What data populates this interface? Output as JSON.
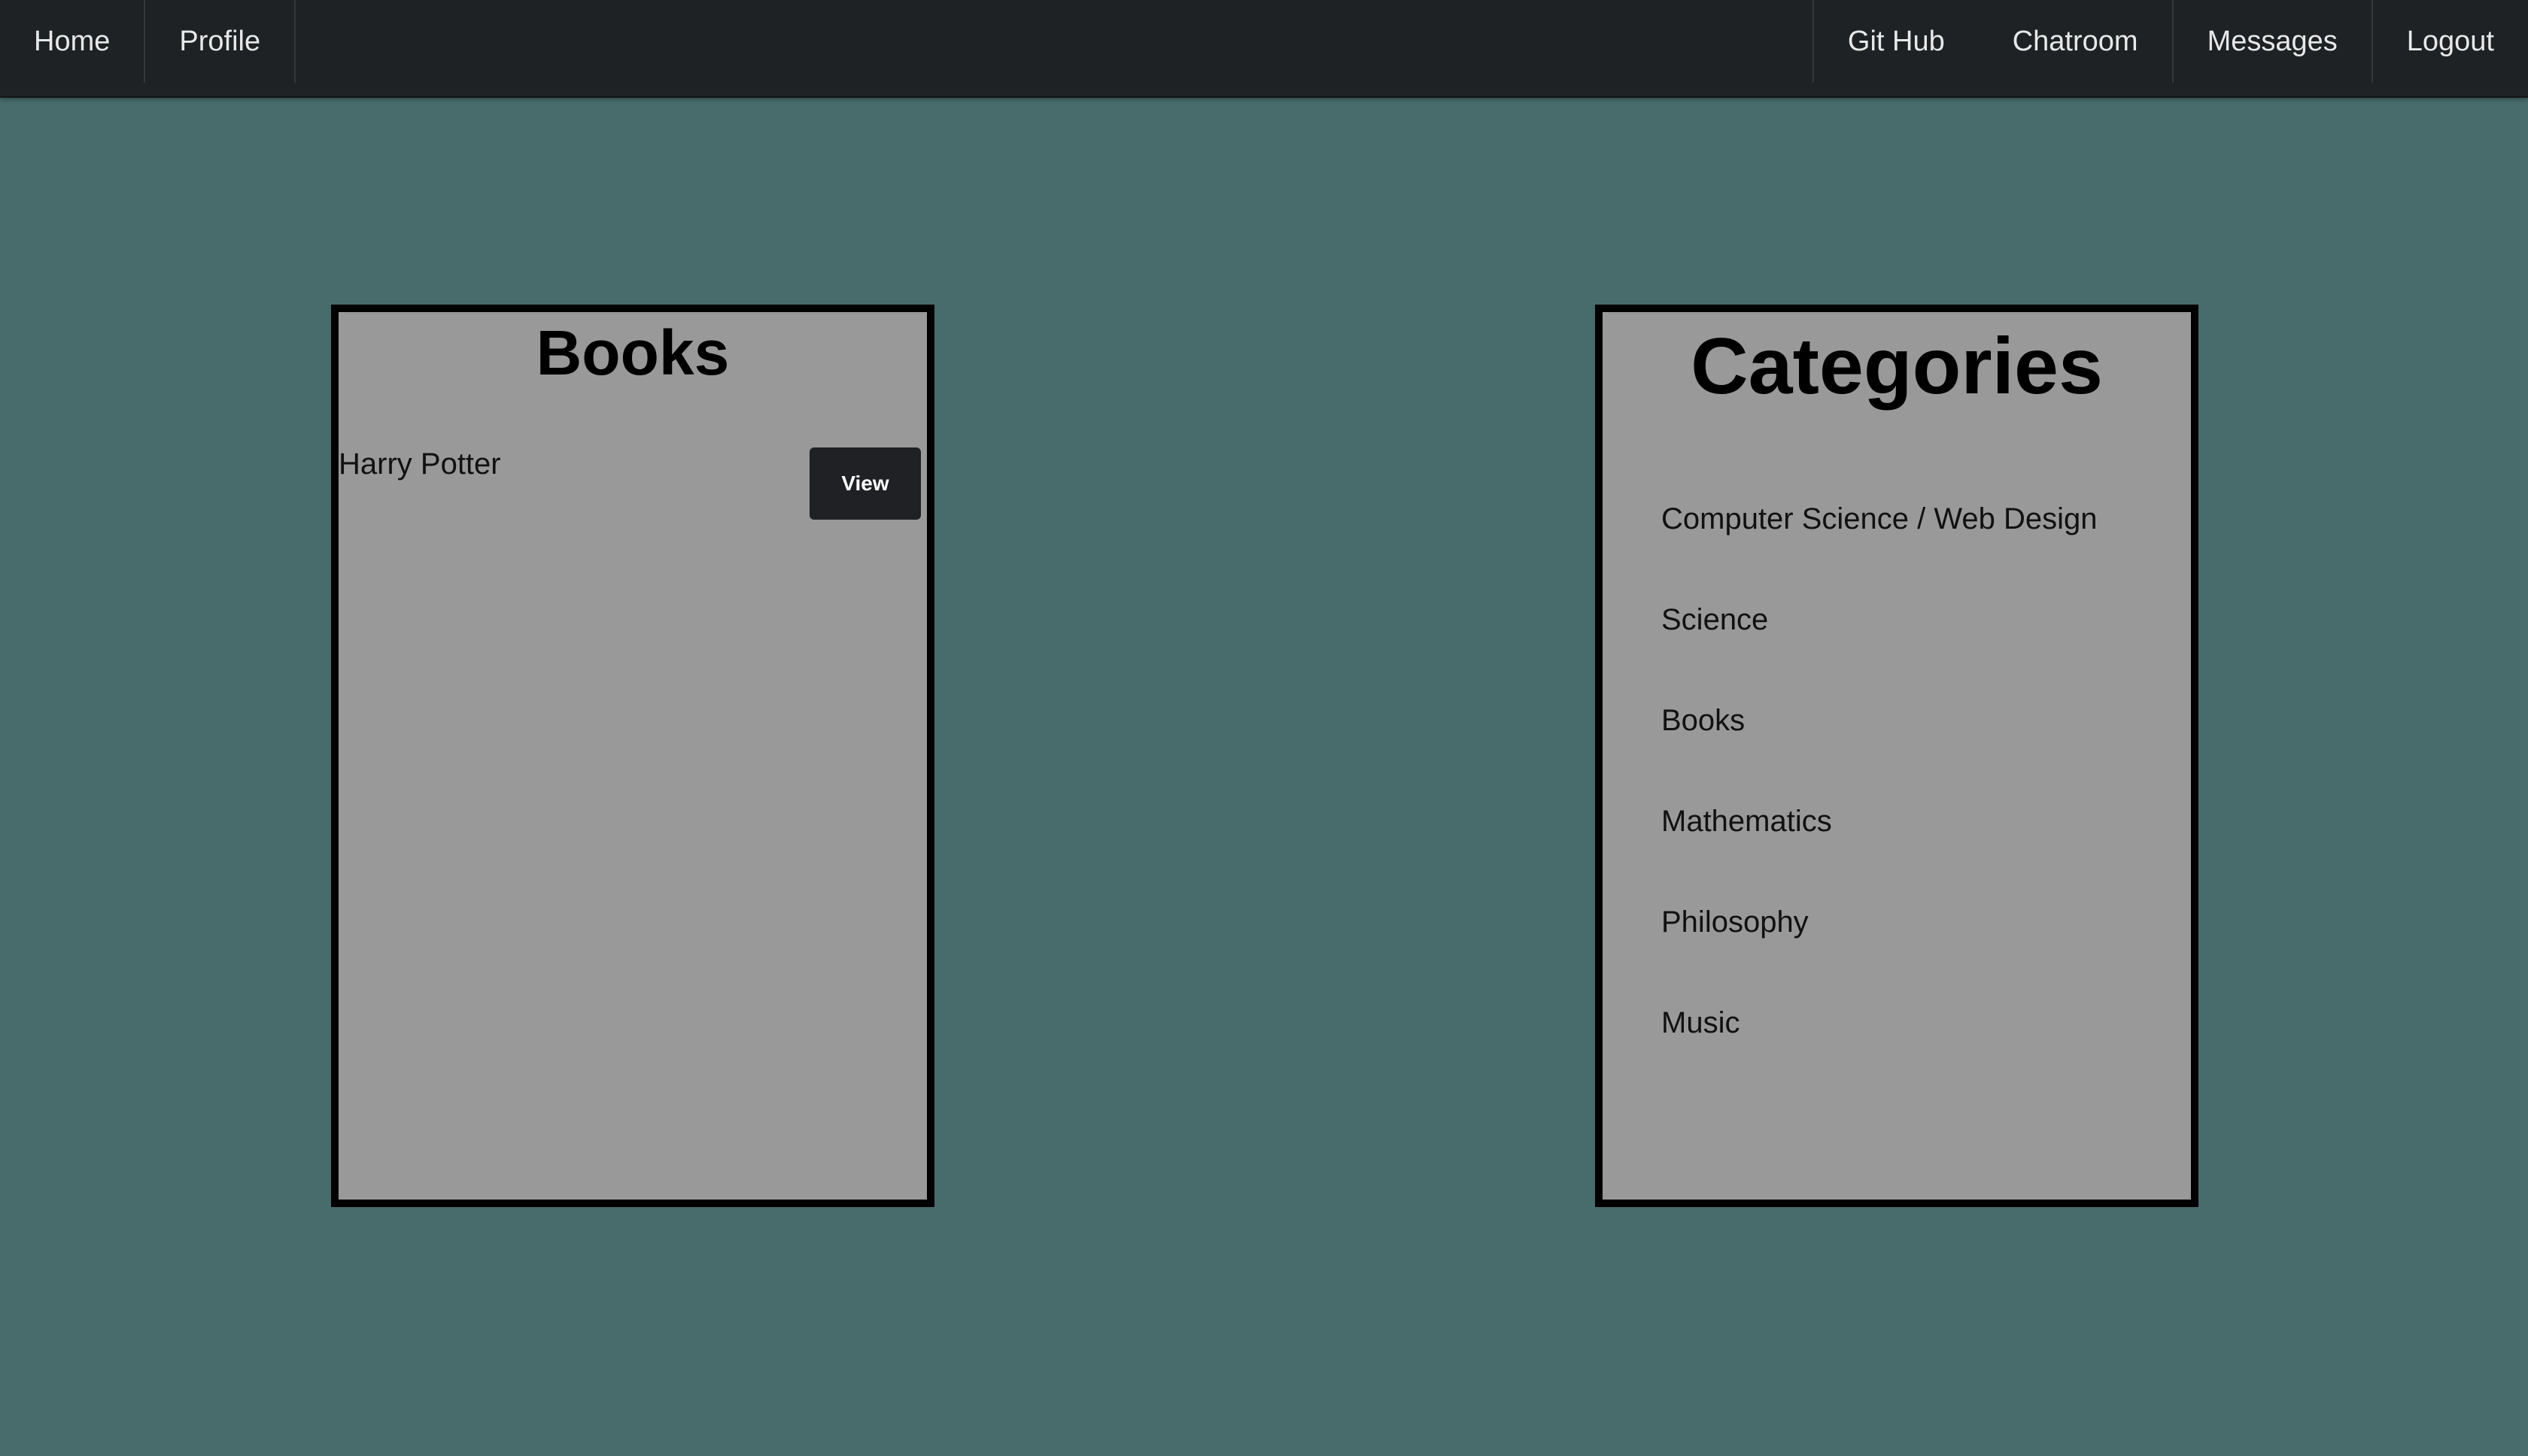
{
  "nav": {
    "left": [
      {
        "label": "Home"
      },
      {
        "label": "Profile"
      }
    ],
    "right": [
      {
        "label": "Git Hub"
      },
      {
        "label": "Chatroom"
      },
      {
        "label": "Messages"
      },
      {
        "label": "Logout"
      }
    ]
  },
  "books_panel": {
    "title": "Books",
    "items": [
      {
        "title": "Harry Potter",
        "button_label": "View"
      }
    ]
  },
  "categories_panel": {
    "title": "Categories",
    "items": [
      "Computer Science / Web Design",
      "Science",
      "Books",
      "Mathematics",
      "Philosophy",
      "Music"
    ]
  }
}
